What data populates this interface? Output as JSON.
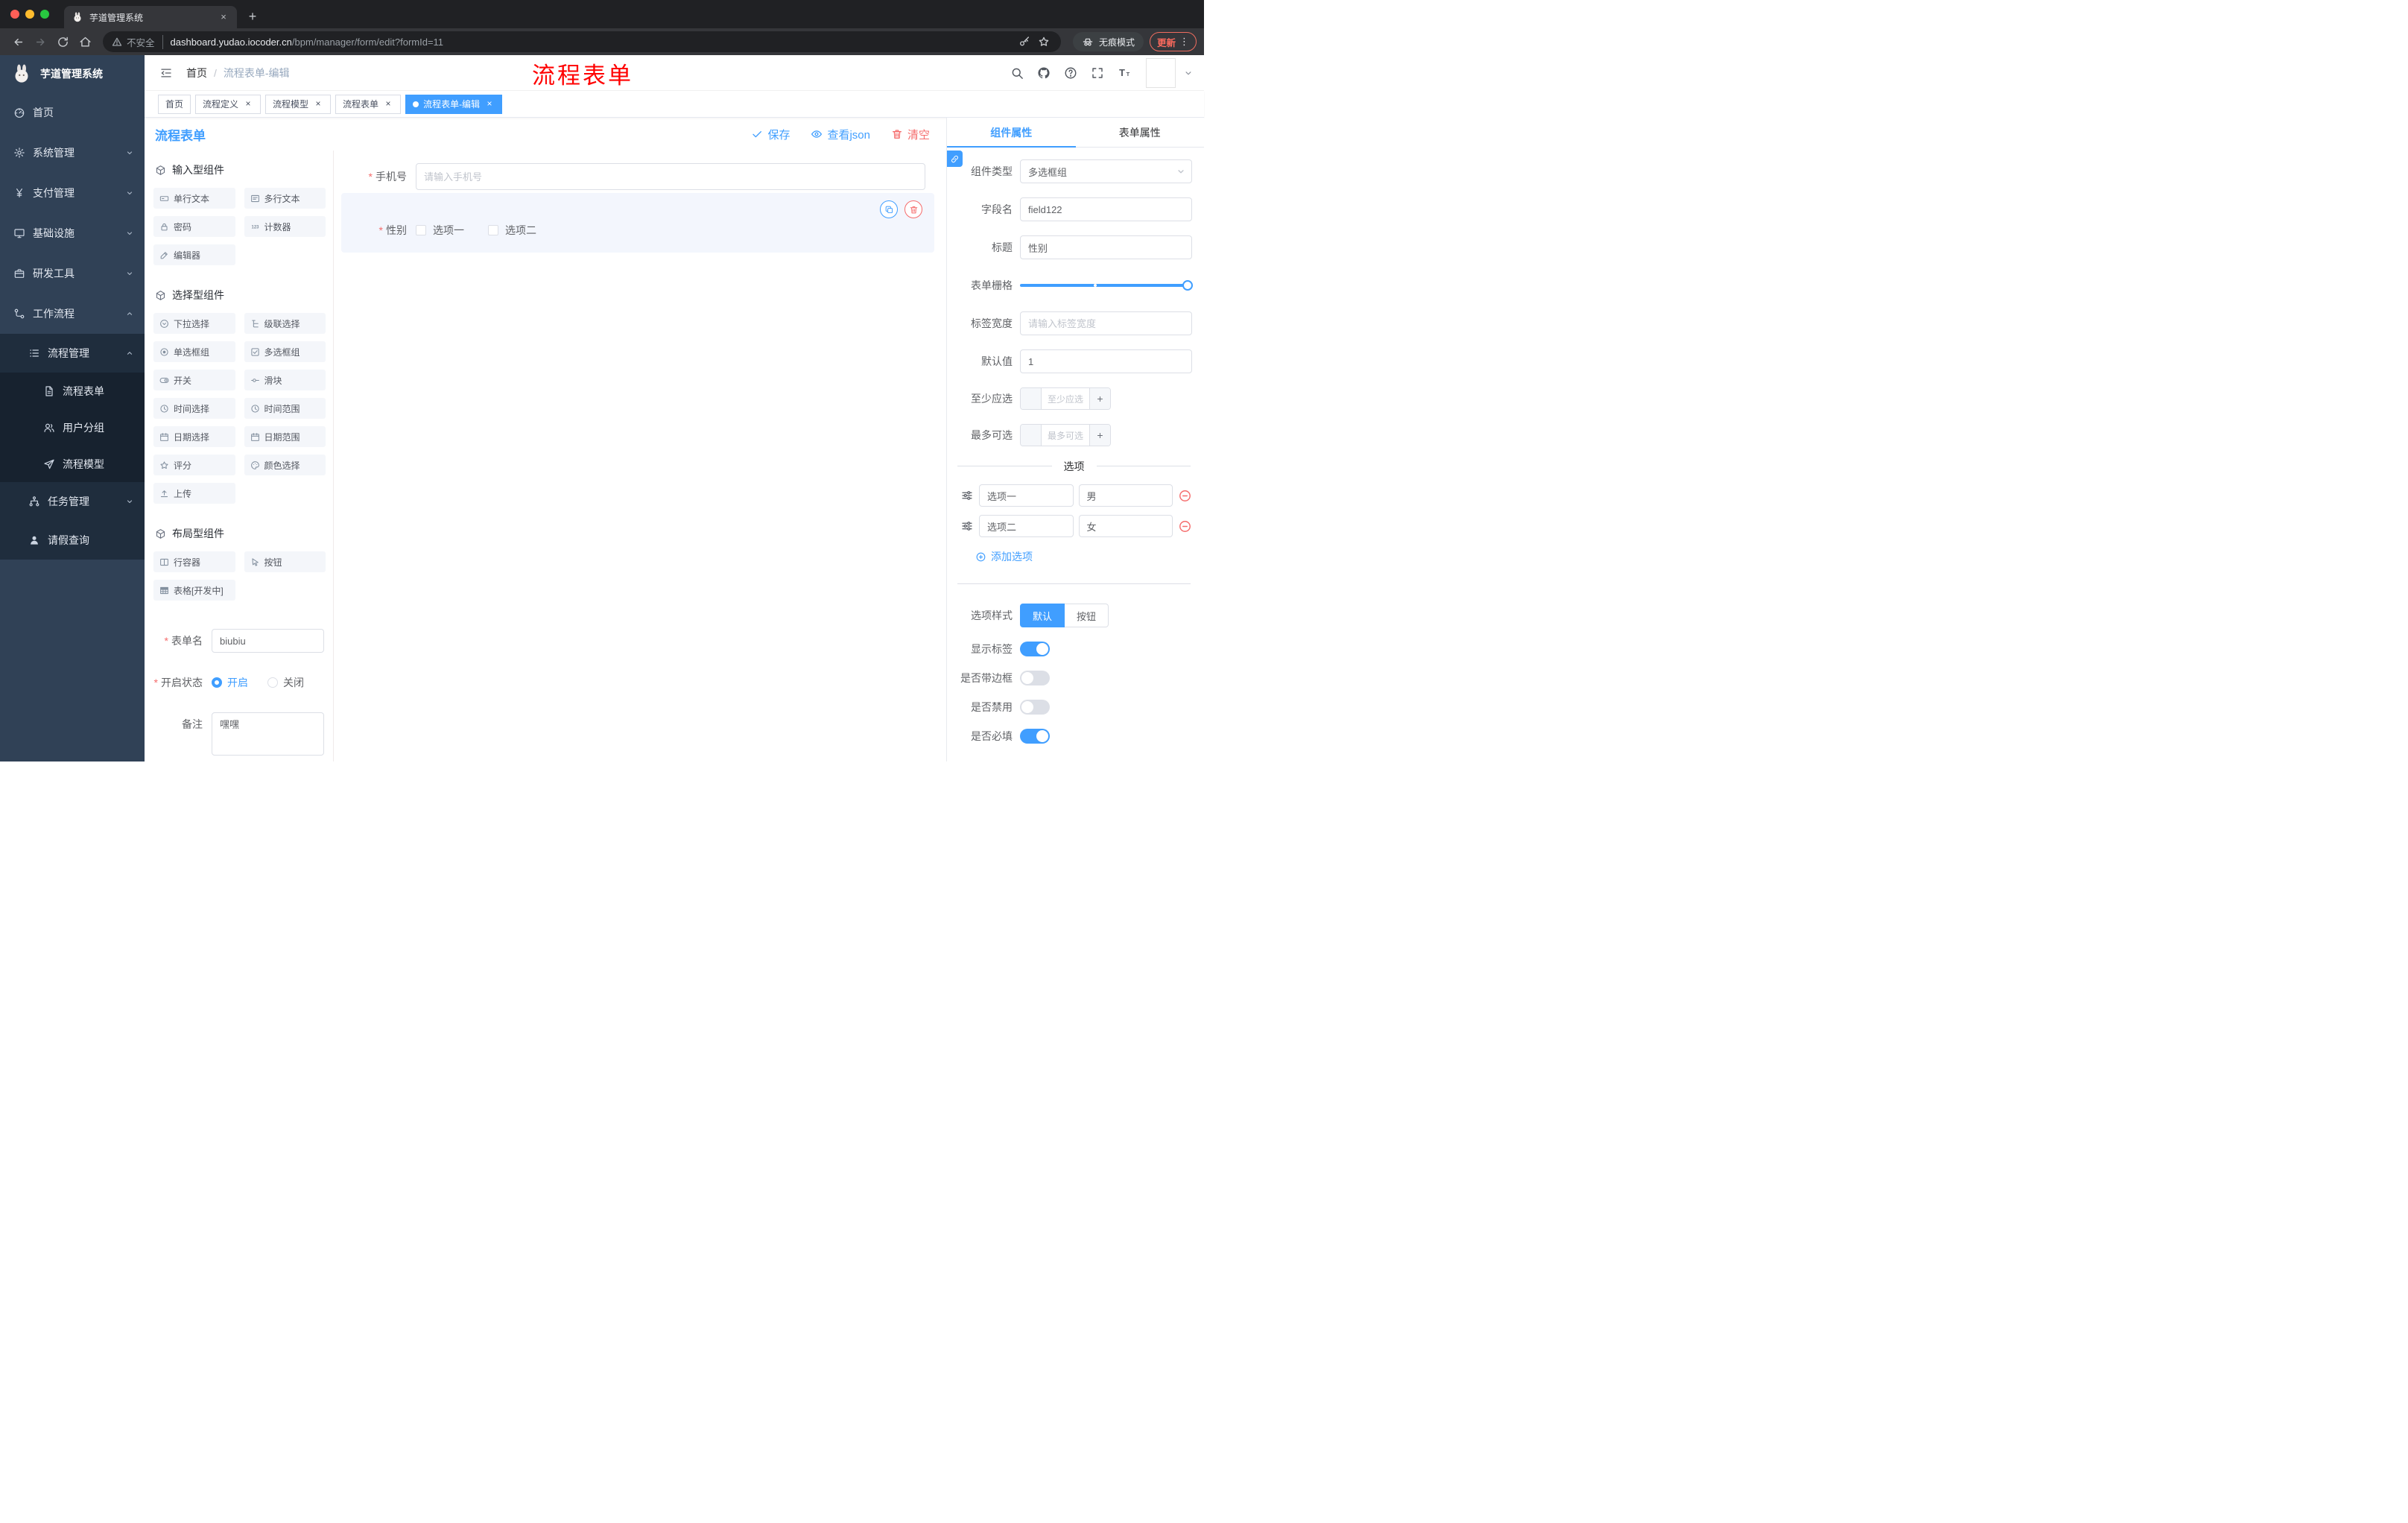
{
  "colors": {
    "accent": "#409eff",
    "danger": "#f56c6c",
    "annotation_red": "#ff0000",
    "sidebar_bg": "#304156"
  },
  "glyphs": {
    "close": "×",
    "plus": "+",
    "dots_vertical": "⋮"
  },
  "browser": {
    "tab_title": "芋道管理系统",
    "security_label": "不安全",
    "url_domain": "dashboard.yudao.iocoder.cn",
    "url_path": "/bpm/manager/form/edit?formId=11",
    "incognito_label": "无痕模式",
    "update_label": "更新"
  },
  "sidebar": {
    "app_title": "芋道管理系统",
    "items": [
      {
        "label": "首页"
      },
      {
        "label": "系统管理"
      },
      {
        "label": "支付管理"
      },
      {
        "label": "基础设施"
      },
      {
        "label": "研发工具"
      },
      {
        "label": "工作流程"
      },
      {
        "label": "流程管理"
      },
      {
        "label": "流程表单"
      },
      {
        "label": "用户分组"
      },
      {
        "label": "流程模型"
      },
      {
        "label": "任务管理"
      },
      {
        "label": "请假查询"
      }
    ]
  },
  "header": {
    "breadcrumb_home": "首页",
    "breadcrumb_sep": "/",
    "breadcrumb_current": "流程表单-编辑",
    "annotation": "流程表单"
  },
  "tags": [
    {
      "label": "首页"
    },
    {
      "label": "流程定义"
    },
    {
      "label": "流程模型"
    },
    {
      "label": "流程表单"
    },
    {
      "label": "流程表单-编辑"
    }
  ],
  "page": {
    "title": "流程表单",
    "save": "保存",
    "view_json": "查看json",
    "clear": "清空"
  },
  "panel": {
    "groups": [
      {
        "title": "输入型组件",
        "items": [
          {
            "label": "单行文本"
          },
          {
            "label": "多行文本"
          },
          {
            "label": "密码"
          },
          {
            "label": "计数器"
          },
          {
            "label": "编辑器"
          }
        ]
      },
      {
        "title": "选择型组件",
        "items": [
          {
            "label": "下拉选择"
          },
          {
            "label": "级联选择"
          },
          {
            "label": "单选框组"
          },
          {
            "label": "多选框组"
          },
          {
            "label": "开关"
          },
          {
            "label": "滑块"
          },
          {
            "label": "时间选择"
          },
          {
            "label": "时间范围"
          },
          {
            "label": "日期选择"
          },
          {
            "label": "日期范围"
          },
          {
            "label": "评分"
          },
          {
            "label": "颜色选择"
          },
          {
            "label": "上传"
          }
        ]
      },
      {
        "title": "布局型组件",
        "items": [
          {
            "label": "行容器"
          },
          {
            "label": "按钮"
          },
          {
            "label": "表格[开发中]"
          }
        ]
      }
    ],
    "form": {
      "name_label": "表单名",
      "name_value": "biubiu",
      "status_label": "开启状态",
      "status_on": "开启",
      "status_off": "关闭",
      "remark_label": "备注",
      "remark_value": "嘿嘿"
    }
  },
  "canvas": {
    "phone_label": "手机号",
    "phone_placeholder": "请输入手机号",
    "gender_label": "性别",
    "gender_opt1": "选项一",
    "gender_opt2": "选项二"
  },
  "props": {
    "tab_component": "组件属性",
    "tab_form": "表单属性",
    "type_label": "组件类型",
    "type_value": "多选框组",
    "field_label": "字段名",
    "field_value": "field122",
    "title_label": "标题",
    "title_value": "性别",
    "grid_label": "表单栅格",
    "width_label": "标签宽度",
    "width_placeholder": "请输入标签宽度",
    "default_label": "默认值",
    "default_value": "1",
    "min_label": "至少应选",
    "min_placeholder": "至少应选",
    "max_label": "最多可选",
    "max_placeholder": "最多可选",
    "options_divider": "选项",
    "options": [
      {
        "name": "选项一",
        "value": "男"
      },
      {
        "name": "选项二",
        "value": "女"
      }
    ],
    "add_option": "添加选项",
    "style_label": "选项样式",
    "style_default": "默认",
    "style_button": "按钮",
    "show_label": "显示标签",
    "border_label": "是否带边框",
    "disabled_label": "是否禁用",
    "required_label": "是否必填"
  }
}
